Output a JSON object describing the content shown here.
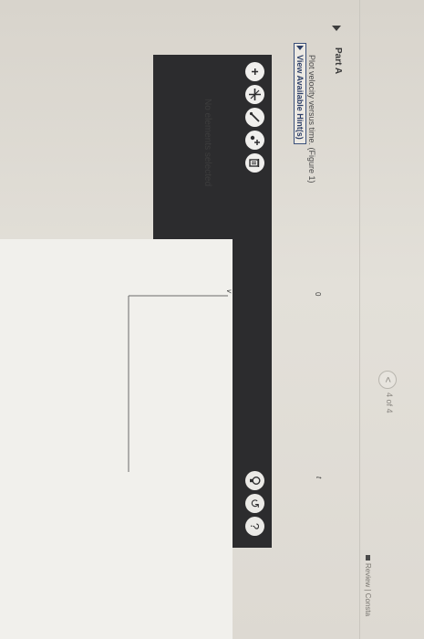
{
  "nav": {
    "back_label": "<",
    "page_count": "4 of 4",
    "review_label": "Review | Consta"
  },
  "part": {
    "title": "Part A",
    "prompt": "Plot velocity versus time. (Figure 1)",
    "hint_label": "View Available Hint(s)"
  },
  "toolbar": {
    "add_label": "+",
    "reset_label": "↺",
    "help_label": "?"
  },
  "status_text": "No elements selected",
  "graph": {
    "y_label": "v",
    "x_label": "t",
    "origin_label": "0"
  }
}
